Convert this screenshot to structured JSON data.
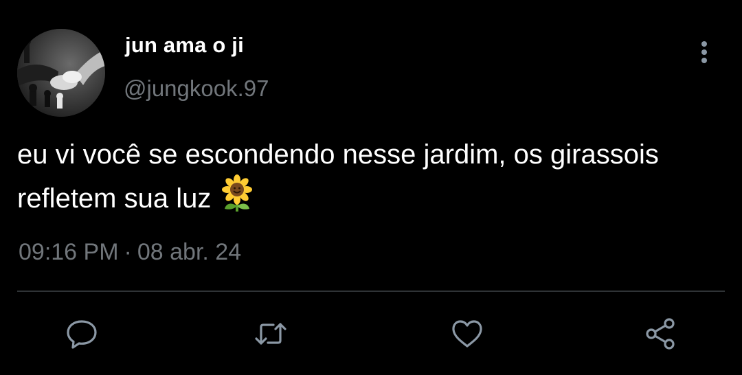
{
  "user": {
    "display_name": "jun ama o ji",
    "handle": "@jungkook.97",
    "avatar_icon": "profile-photo-holding-hands"
  },
  "tweet": {
    "text": "eu vi você se escondendo nesse jardim, os girassois refletem sua luz",
    "emoji": "🌻",
    "time": "09:16 PM",
    "separator": "·",
    "date": "08 abr. 24"
  },
  "actions": {
    "reply_icon": "reply-icon",
    "retweet_icon": "retweet-icon",
    "like_icon": "heart-icon",
    "share_icon": "share-icon",
    "more_icon": "more-vertical-icon"
  },
  "colors": {
    "background": "#000000",
    "primary_text": "#ffffff",
    "secondary_text": "#71767b",
    "icon": "#8b98a5",
    "divider": "#2f3336"
  }
}
